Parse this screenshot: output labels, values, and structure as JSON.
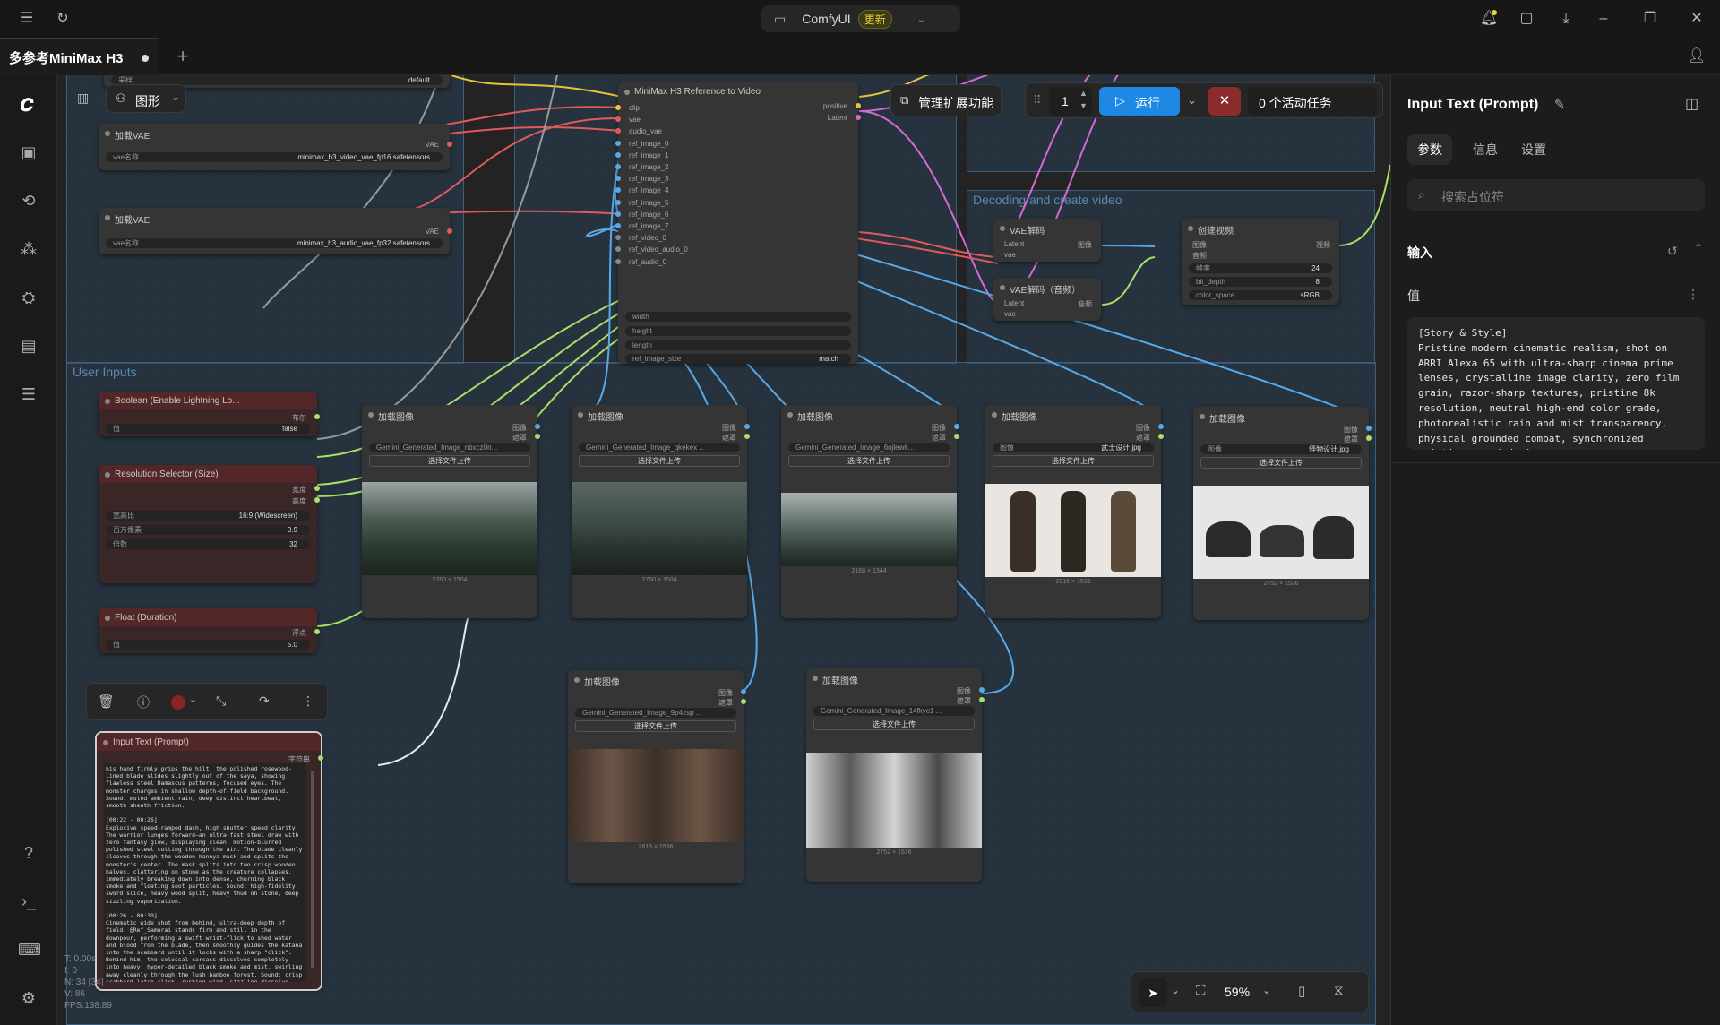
{
  "titlebar": {
    "app": "ComfyUI",
    "update_badge": "更新"
  },
  "tab": {
    "title": "多参考MiniMax H3"
  },
  "canvas_toolbar": {
    "graph_label": "图形",
    "manage_ext": "管理扩展功能",
    "run_count": "1",
    "run_label": "运行",
    "active_tasks": "0 个活动任务"
  },
  "groups": {
    "decode": "Decoding and create video",
    "user_inputs": "User Inputs"
  },
  "nodes": {
    "ref_node": {
      "title": "MiniMax H3 Reference to Video",
      "inputs": [
        "clip",
        "vae",
        "audio_vae",
        "ref_image_0",
        "ref_image_1",
        "ref_image_2",
        "ref_image_3",
        "ref_image_4",
        "ref_image_5",
        "ref_image_6",
        "ref_image_7",
        "ref_video_0",
        "ref_video_audio_0",
        "ref_audio_0"
      ],
      "outputs": [
        "positive",
        "Latent"
      ],
      "widgets": [
        "width",
        "height",
        "length"
      ],
      "ref_image_size_label": "ref_image_size",
      "ref_image_size_value": "match"
    },
    "vae1": {
      "title": "加载VAE",
      "out": "VAE",
      "w_label": "vae名称",
      "w_value": "minimax_h3_video_vae_fp16.safetensors"
    },
    "vae2": {
      "title": "加载VAE",
      "out": "VAE",
      "w_label": "vae名称",
      "w_value": "minimax_h3_audio_vae_fp32.safetensors"
    },
    "top_widget": {
      "label": "采样",
      "value": "default"
    },
    "vae_decode": {
      "title": "VAE解码",
      "in": [
        "Latent",
        "vae"
      ],
      "out": "图像"
    },
    "vae_decode_audio": {
      "title": "VAE解码（音频）",
      "in": [
        "Latent",
        "vae"
      ],
      "out": "音频"
    },
    "create_video": {
      "title": "创建视频",
      "in": [
        "图像",
        "音频"
      ],
      "out": "视频",
      "widgets": [
        {
          "l": "帧率",
          "v": "24"
        },
        {
          "l": "bit_depth",
          "v": "8"
        },
        {
          "l": "color_space",
          "v": "sRGB"
        }
      ]
    },
    "boolean": {
      "title": "Boolean (Enable Lightning Lo...",
      "out": "布尔",
      "w_label": "值",
      "w_value": "false"
    },
    "resolution": {
      "title": "Resolution Selector (Size)",
      "outs": [
        "宽度",
        "高度"
      ],
      "widgets": [
        {
          "l": "宽高比",
          "v": "16:9 (Widescreen)"
        },
        {
          "l": "百万像素",
          "v": "0.9"
        },
        {
          "l": "倍数",
          "v": "32"
        }
      ]
    },
    "float": {
      "title": "Float (Duration)",
      "out": "浮点",
      "w_label": "值",
      "w_value": "5.0"
    },
    "input_text": {
      "title": "Input Text (Prompt)",
      "out": "字符串"
    }
  },
  "load_images": [
    {
      "title": "加载图像",
      "file": "Gemini_Generated_Image_nbxcz0n...",
      "upload": "选择文件上传",
      "dim": "2760 × 1504",
      "outs": [
        "图像",
        "遮罩"
      ]
    },
    {
      "title": "加载图像",
      "file": "Gemini_Generated_Image_qkekex ...",
      "upload": "选择文件上传",
      "dim": "2760 × 1504",
      "outs": [
        "图像",
        "遮罩"
      ]
    },
    {
      "title": "加载图像",
      "file": "Gemini_Generated_Image_6ojlew6...",
      "upload": "选择文件上传",
      "dim": "2168 × 1344",
      "outs": [
        "图像",
        "遮罩"
      ]
    },
    {
      "title": "加载图像",
      "file": "武士设计.jpg",
      "label": "图像",
      "upload": "选择文件上传",
      "dim": "2016 × 1536",
      "outs": [
        "图像",
        "遮罩"
      ]
    },
    {
      "title": "加载图像",
      "file": "怪物设计.jpg",
      "label": "图像",
      "upload": "选择文件上传",
      "dim": "2752 × 1536",
      "outs": [
        "图像",
        "遮罩"
      ]
    },
    {
      "title": "加载图像",
      "file": "Gemini_Generated_Image_9p4zsp ...",
      "upload": "选择文件上传",
      "dim": "2816 × 1536",
      "outs": [
        "图像",
        "遮罩"
      ]
    },
    {
      "title": "加载图像",
      "file": "Gemini_Generated_Image_14fkyc1 ...",
      "upload": "选择文件上传",
      "dim": "2752 × 1536",
      "outs": [
        "图像",
        "遮罩"
      ]
    }
  ],
  "node_prompt_text": "his hand firmly grips the hilt, the polished rosewood-lined blade slides slightly out of the saya, showing flawless steel Damascus patterns, focused eyes. The monster charges in shallow depth-of-field background. Sound: muted ambient rain, deep distinct heartbeat, smooth sheath friction.\n\n[00:22 - 00:26]\nExplosive speed-ramped dash, high shutter speed clarity. The warrior lunges forward—an ultra-fast steel draw with zero fantasy glow, displaying clean, motion-blurred polished steel cutting through the air. The blade cleanly cleaves through the wooden hannya mask and splits the monster's center. The mask splits into two crisp wooden halves, clattering on stone as the creature collapses, immediately breaking down into dense, churning black smoke and floating soot particles. Sound: high-fidelity sword slice, heavy wood split, heavy thud on stone, deep sizzling vaporization.\n\n[00:26 - 00:30]\nCinematic wide shot from behind, ultra-deep depth of field. @Ref_Samurai stands firm and still in the downpour, performing a swift wrist-flick to shed water and blood from the blade, then smoothly guides the katana into the scabbard until it locks with a sharp \"click\". Behind him, the colossal carcass dissolves completely into heavy, hyper-detailed black smoke and mist, swirling away cleanly through the lush bamboo forest. Sound: crisp scabbard latch click, rushing wind, sizzling dissolve, clear rain falling on bamboo leaves.",
  "stats": {
    "t": "T: 0.00s",
    "i": "I: 0",
    "n": "N: 34 [34]",
    "v": "V: 86",
    "fps": "FPS:138.89"
  },
  "bottom_toolbar": {
    "zoom": "59%"
  },
  "right_panel": {
    "title": "Input Text (Prompt)",
    "tabs": [
      "参数",
      "信息",
      "设置"
    ],
    "search_placeholder": "搜索占位符",
    "section": "输入",
    "value_label": "值",
    "prompt": "[Story & Style]\nPristine modern cinematic realism, shot on ARRI Alexa 65 with ultra-sharp cinema prime lenses, crystalline image clarity, zero film grain, razor-sharp textures, pristine 8k resolution, neutral high-end color grade, photorealistic rain and mist transparency, physical grounded combat, synchronized pristine sound design."
  },
  "colors": {
    "accent": "#1e88e5",
    "group": "#2a4760",
    "wire_pink": "#d36bd3",
    "wire_blue": "#5aa9e6",
    "wire_yellow": "#e8c43a",
    "wire_green": "#a8e06a",
    "wire_red": "#e05a5a"
  }
}
